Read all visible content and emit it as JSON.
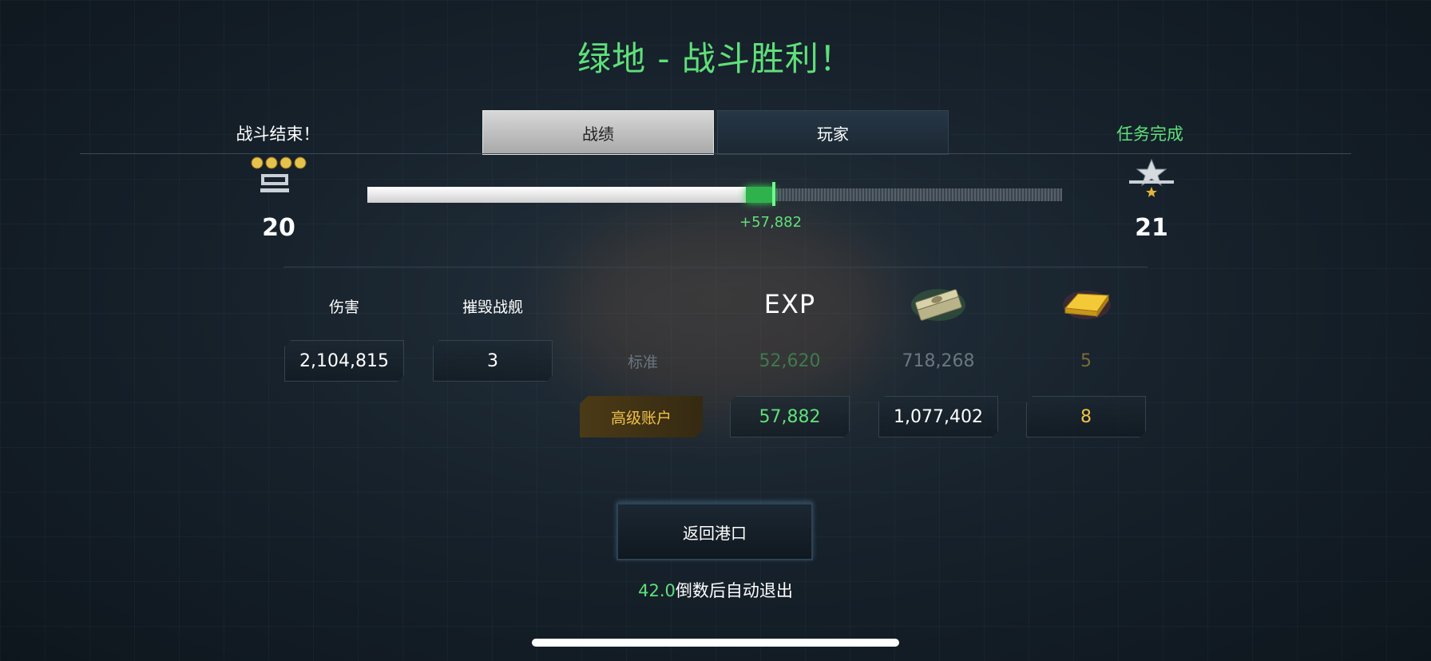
{
  "header": {
    "title": "绿地 - 战斗胜利！"
  },
  "left_label": "战斗结束！",
  "right_label": "任务完成",
  "tabs": [
    {
      "label": "战绩",
      "active": true
    },
    {
      "label": "玩家",
      "active": false
    }
  ],
  "progress": {
    "current_rank": "20",
    "next_rank": "21",
    "gain_text": "+57,882",
    "previous_fill_fraction": 0.545,
    "new_fill_fraction": 0.585
  },
  "stats": {
    "damage_label": "伤害",
    "damage_value": "2,104,815",
    "destroyed_label": "摧毁战舰",
    "destroyed_value": "3"
  },
  "rewards": {
    "exp_label": "EXP",
    "standard_label": "标准",
    "standard_exp": "52,620",
    "standard_credits": "718,268",
    "standard_gold": "5",
    "premium_label": "高级账户",
    "premium_exp": "57,882",
    "premium_credits": "1,077,402",
    "premium_gold": "8"
  },
  "return_button": "返回港口",
  "countdown": {
    "seconds": "42.0",
    "text": "倒数后自动退出"
  },
  "colors": {
    "accent_green": "#5fe07a",
    "gold": "#f0c24a"
  },
  "icons": [
    "rank-insignia-icon",
    "next-rank-star-icon",
    "credits-cash-icon",
    "gold-bar-icon"
  ]
}
